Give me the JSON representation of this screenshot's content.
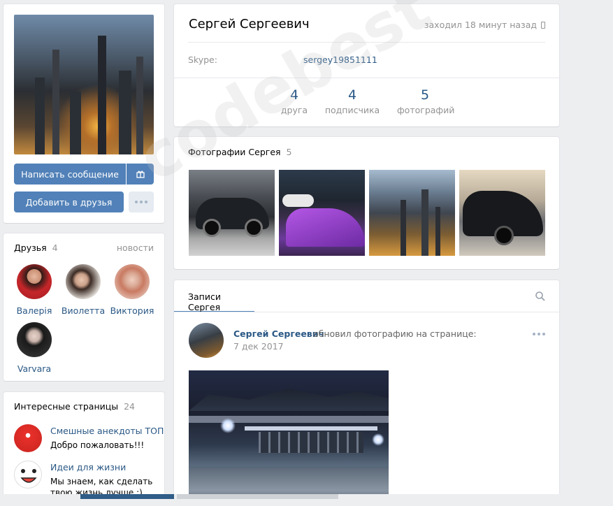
{
  "profile": {
    "name": "Сергей Сергеевич",
    "last_seen": "заходил 18 минут назад",
    "skype_label": "Skype:",
    "skype_value": "sergey19851111",
    "counters": [
      {
        "num": "4",
        "label": "друга"
      },
      {
        "num": "4",
        "label": "подписчика"
      },
      {
        "num": "5",
        "label": "фотографий"
      }
    ]
  },
  "actions": {
    "send_message": "Написать сообщение",
    "add_friend": "Добавить в друзья"
  },
  "friends": {
    "title": "Друзья",
    "count": "4",
    "news_link": "новости",
    "items": [
      {
        "name": "Валерія"
      },
      {
        "name": "Виолетта"
      },
      {
        "name": "Виктория"
      },
      {
        "name": "Varvara"
      }
    ]
  },
  "pages": {
    "title": "Интересные страницы",
    "count": "24",
    "items": [
      {
        "name": "Смешные анекдоты ТОП",
        "desc": "Добро пожаловать!!!"
      },
      {
        "name": "Идеи для жизни",
        "desc": "Мы знаем, как сделать",
        "desc2": "твою жизнь лучше :)"
      }
    ]
  },
  "photos": {
    "title": "Фотографии Сергея",
    "count": "5"
  },
  "wall": {
    "tab_label": "Записи Сергея",
    "post": {
      "author": "Сергей Сергеевич",
      "action": "обновил фотографию на странице:",
      "date": "7 дек 2017"
    }
  },
  "colors": {
    "accent": "#5181b8",
    "link": "#2a5885",
    "muted": "#939393",
    "background": "#edeef0"
  },
  "watermark": "codebest"
}
